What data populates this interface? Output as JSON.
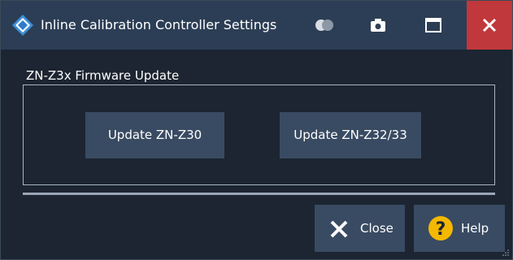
{
  "window": {
    "title": "Inline Calibration Controller Settings"
  },
  "titlebar": {
    "icons": [
      "rs-logo-icon",
      "toggle-icon",
      "camera-icon",
      "maximize-icon",
      "close-icon"
    ],
    "close_color": "#c0383b"
  },
  "group": {
    "label": "ZN-Z3x Firmware Update",
    "buttons": [
      {
        "label": "Update ZN-Z30"
      },
      {
        "label": "Update ZN-Z32/33"
      }
    ]
  },
  "footer": {
    "close_label": "Close",
    "help_label": "Help",
    "close_icon": "x-icon",
    "help_icon": "question-icon",
    "help_icon_color": "#f5b800"
  },
  "colors": {
    "background": "#1c2531",
    "titlebar": "#2c3e55",
    "button": "#394b62"
  }
}
